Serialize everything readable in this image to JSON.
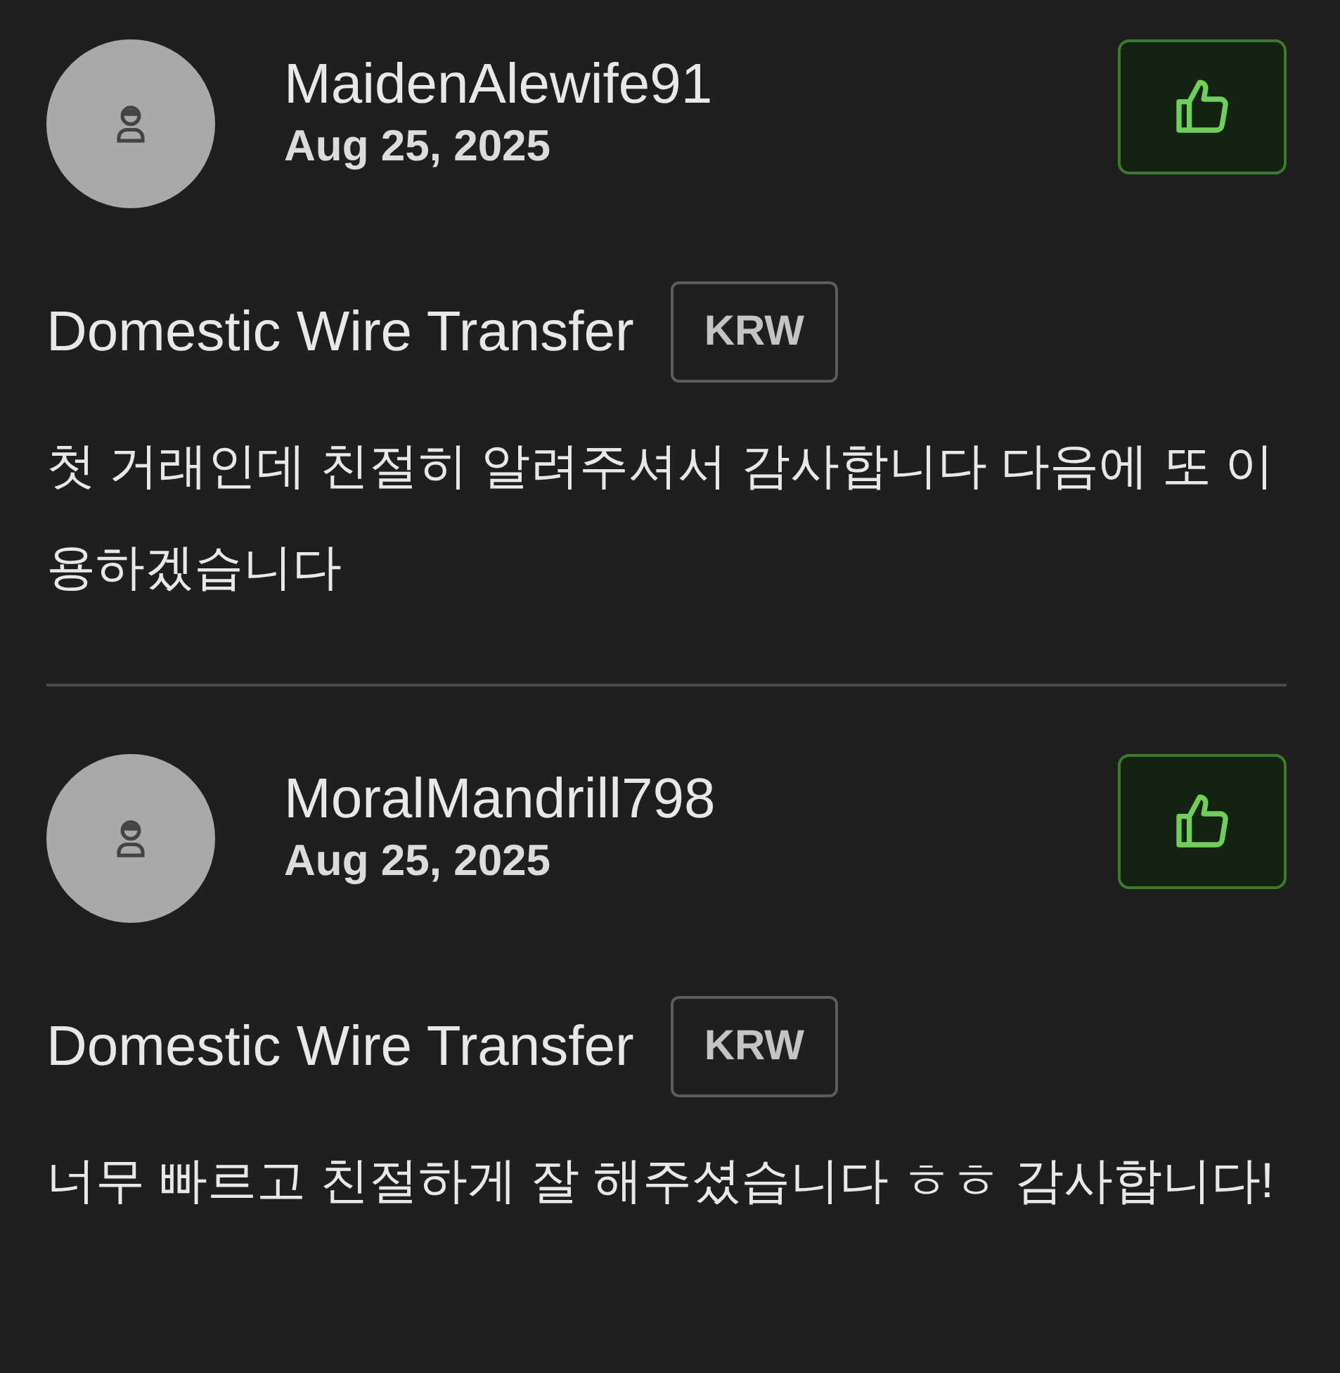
{
  "reviews": [
    {
      "username": "MaidenAlewife91",
      "date": "Aug 25, 2025",
      "method": "Domestic Wire Transfer",
      "currency": "KRW",
      "comment": "첫 거래인데 친절히 알려주셔서 감사합니다 다음에 또 이용하겠습니다"
    },
    {
      "username": "MoralMandrill798",
      "date": "Aug 25, 2025",
      "method": "Domestic Wire Transfer",
      "currency": "KRW",
      "comment": "너무 빠르고 친절하게 잘 해주셨습니다 ㅎㅎ 감사합니다!"
    }
  ]
}
